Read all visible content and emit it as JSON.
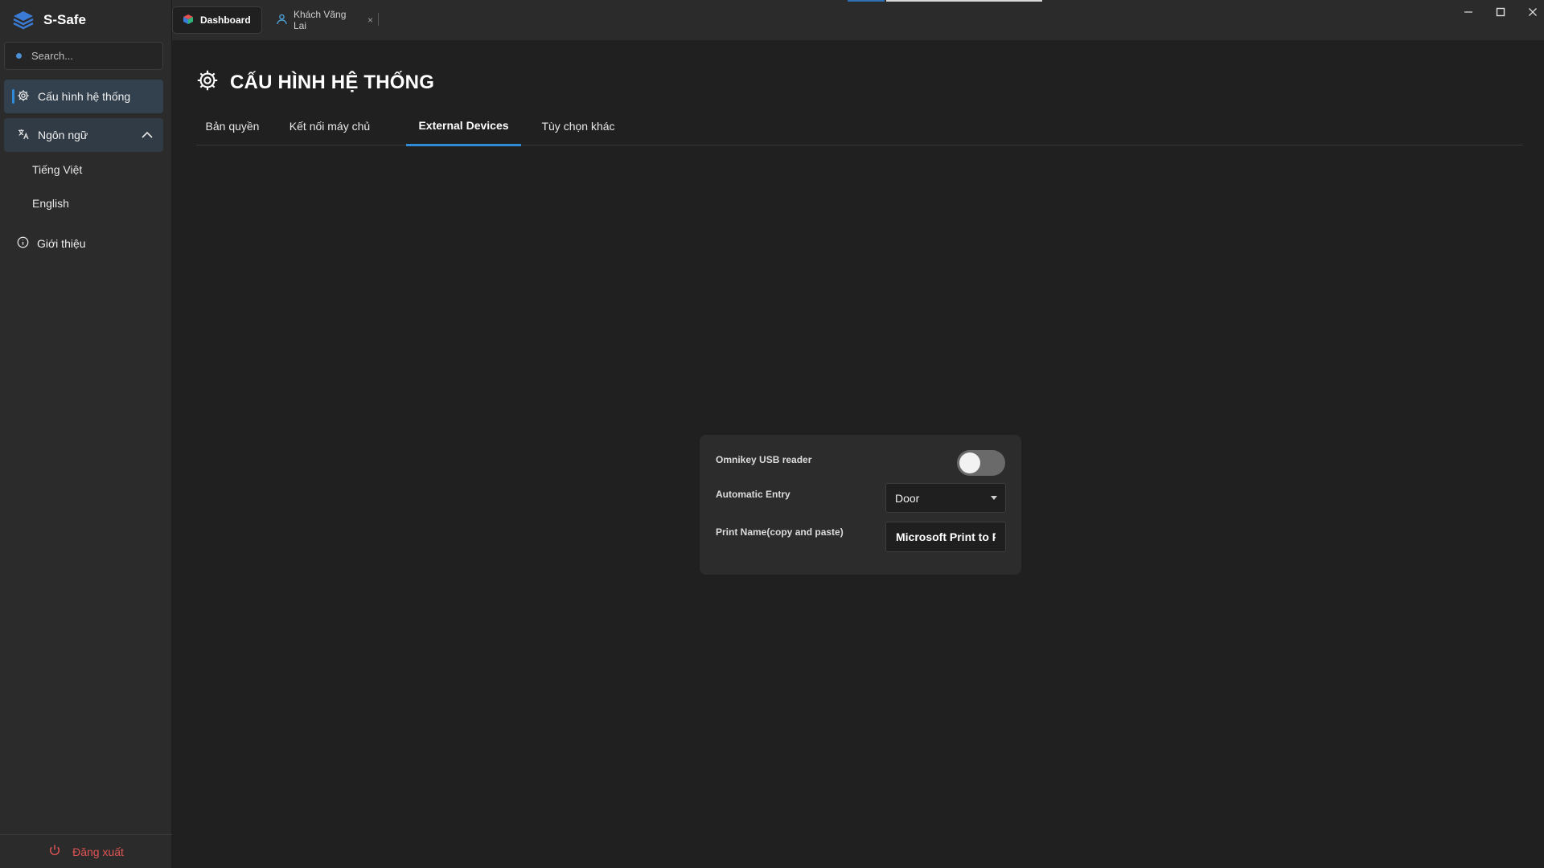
{
  "app": {
    "name": "S-Safe"
  },
  "search": {
    "placeholder": "Search..."
  },
  "sidebar": {
    "items": [
      {
        "label": "Cấu hình hệ thống"
      },
      {
        "label": "Ngôn ngữ",
        "children": [
          {
            "label": "Tiếng Việt"
          },
          {
            "label": "English"
          }
        ]
      },
      {
        "label": "Giới thiệu"
      }
    ],
    "logout": "Đăng xuất"
  },
  "window_tabs": [
    {
      "label": "Dashboard"
    },
    {
      "label": "Khách Vãng Lai",
      "close": "×"
    }
  ],
  "page": {
    "title": "CẤU HÌNH HỆ THỐNG",
    "tabs": [
      "Bản quyền",
      "Kết nối máy chủ",
      "External Devices",
      "Tùy chọn khác"
    ],
    "active_tab": "External Devices"
  },
  "form": {
    "omnikey_label": "Omnikey USB reader",
    "omnikey_enabled": false,
    "automatic_entry_label": "Automatic Entry",
    "automatic_entry_value": "Door",
    "print_name_label": "Print Name(copy and paste)",
    "print_name_value": "Microsoft Print to PDF"
  },
  "colors": {
    "accent": "#2f8bd8",
    "danger": "#e05454",
    "background": "#202020",
    "sidebar": "#2b2b2b"
  }
}
